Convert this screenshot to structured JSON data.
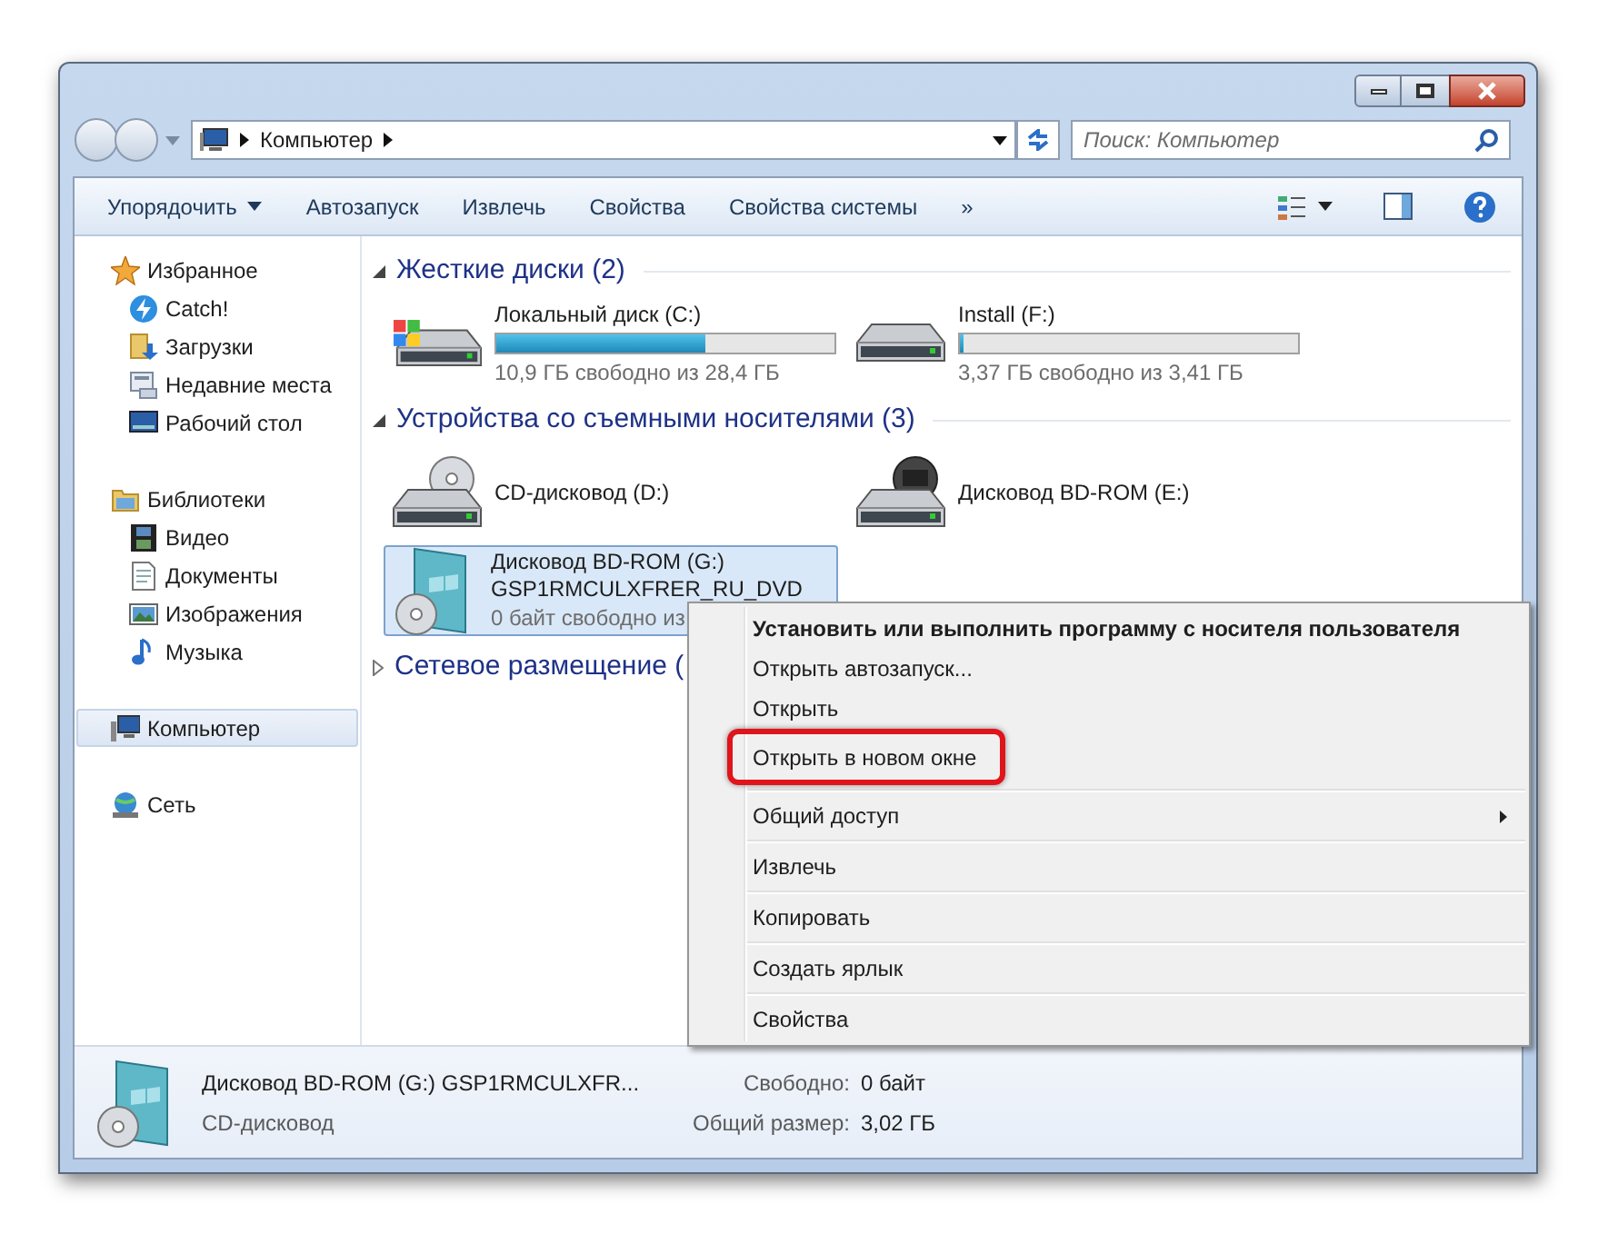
{
  "address": {
    "path": [
      "Компьютер"
    ]
  },
  "search": {
    "placeholder": "Поиск: Компьютер"
  },
  "toolbar": [
    "Упорядочить",
    "Автозапуск",
    "Извлечь",
    "Свойства",
    "Свойства системы",
    "»"
  ],
  "sidebar": {
    "groups": [
      {
        "label": "Избранное",
        "kind": "star",
        "selected": false,
        "children": [
          {
            "label": "Catch!",
            "kind": "bolt",
            "selected": false
          },
          {
            "label": "Загрузки",
            "kind": "download",
            "selected": false
          },
          {
            "label": "Недавние места",
            "kind": "recent",
            "selected": false
          },
          {
            "label": "Рабочий стол",
            "kind": "desktop",
            "selected": false
          }
        ]
      },
      {
        "label": "Библиотеки",
        "kind": "library",
        "selected": false,
        "children": [
          {
            "label": "Видео",
            "kind": "video",
            "selected": false
          },
          {
            "label": "Документы",
            "kind": "document",
            "selected": false
          },
          {
            "label": "Изображения",
            "kind": "image",
            "selected": false
          },
          {
            "label": "Музыка",
            "kind": "music",
            "selected": false
          }
        ]
      },
      {
        "label": "Компьютер",
        "kind": "computer",
        "selected": true
      },
      {
        "label": "Сеть",
        "kind": "network",
        "selected": false
      }
    ]
  },
  "sections": [
    {
      "title": "Жесткие диски (2)",
      "expanded": true,
      "items": [
        {
          "kind": "hdd_windows",
          "name": "Локальный диск (C:)",
          "level": 0.62,
          "info": "10,9 ГБ свободно из 28,4 ГБ",
          "selected": false
        },
        {
          "kind": "hdd",
          "name": "Install (F:)",
          "level": 0.01,
          "info": "3,37 ГБ свободно из 3,41 ГБ",
          "selected": false
        }
      ]
    },
    {
      "title": "Устройства со съемными носителями (3)",
      "expanded": true,
      "items": [
        {
          "kind": "cd",
          "name": "CD-дисковод (D:)",
          "selected": false
        },
        {
          "kind": "bd",
          "name": "Дисковод BD-ROM (E:)",
          "selected": false
        },
        {
          "kind": "media",
          "name": "Дисковод BD-ROM (G:)",
          "label": "GSP1RMCULXFRER_RU_DVD",
          "info": "0 байт свободно из",
          "selected": true
        }
      ]
    },
    {
      "title": "Сетевое размещение (",
      "expanded": false
    }
  ],
  "context_menu": [
    {
      "label": "Установить или выполнить программу с носителя пользователя",
      "bold": true,
      "highlighted": false,
      "submenu": false,
      "separator_after": false
    },
    {
      "label": "Открыть автозапуск...",
      "bold": false,
      "highlighted": false,
      "submenu": false,
      "separator_after": false
    },
    {
      "label": "Открыть",
      "bold": false,
      "highlighted": false,
      "submenu": false,
      "separator_after": false
    },
    {
      "label": "Открыть в новом окне",
      "bold": false,
      "highlighted": true,
      "submenu": false,
      "separator_after": true
    },
    {
      "label": "Общий доступ",
      "bold": false,
      "highlighted": false,
      "submenu": true,
      "separator_after": true
    },
    {
      "label": "Извлечь",
      "bold": false,
      "highlighted": false,
      "submenu": false,
      "separator_after": true
    },
    {
      "label": "Копировать",
      "bold": false,
      "highlighted": false,
      "submenu": false,
      "separator_after": true
    },
    {
      "label": "Создать ярлык",
      "bold": false,
      "highlighted": false,
      "submenu": false,
      "separator_after": true
    },
    {
      "label": "Свойства",
      "bold": false,
      "highlighted": false,
      "submenu": false,
      "separator_after": false
    }
  ],
  "details": {
    "name": "Дисковод BD-ROM (G:) GSP1RMCULXFR...",
    "type": "CD-дисковод",
    "fields": [
      {
        "label": "Свободно:",
        "value": "0 байт"
      },
      {
        "label": "Общий размер:",
        "value": "3,02 ГБ"
      }
    ]
  }
}
